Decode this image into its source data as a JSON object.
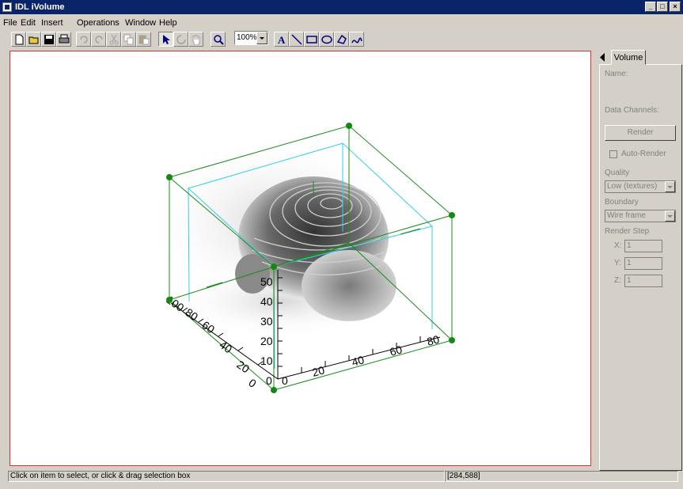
{
  "window": {
    "title": "IDL iVolume",
    "minimize": "_",
    "maximize": "□",
    "close": "×"
  },
  "menu": [
    "File",
    "Edit",
    "Insert",
    "Operations",
    "Window",
    "Help"
  ],
  "toolbar": {
    "zoom_value": "100%",
    "text_tool_label": "A",
    "icons": [
      "new-file-icon",
      "open-folder-icon",
      "save-icon",
      "print-icon",
      "undo-icon",
      "redo-icon",
      "cut-icon",
      "copy-icon",
      "paste-icon",
      "select-arrow-icon",
      "rotate-icon",
      "pan-hand-icon",
      "zoom-icon",
      "text-icon",
      "line-icon",
      "rectangle-icon",
      "ellipse-icon",
      "polygon-icon",
      "freehand-icon"
    ]
  },
  "canvas": {
    "axis_y_ticks": [
      "0",
      "10",
      "20",
      "30",
      "40",
      "50"
    ],
    "axis_x_ticks": [
      "0",
      "20",
      "40",
      "60",
      "80"
    ],
    "axis_z_ticks": [
      "0",
      "20",
      "40",
      "60",
      "80",
      "100"
    ],
    "colors": {
      "bbox": "#1a8a1a",
      "inner_box": "#30d0e0",
      "handle": "#128a12",
      "border": "#e03030"
    }
  },
  "panel": {
    "tab": "Volume",
    "name_label": "Name:",
    "data_channels_label": "Data Channels:",
    "render_button": "Render",
    "auto_render_label": "Auto-Render",
    "quality_label": "Quality",
    "quality_value": "Low (textures)",
    "boundary_label": "Boundary",
    "boundary_value": "Wire frame",
    "render_step_label": "Render Step",
    "step_x_label": "X:",
    "step_x_value": "1",
    "step_y_label": "Y:",
    "step_y_value": "1",
    "step_z_label": "Z:",
    "step_z_value": "1"
  },
  "status": {
    "message": "Click on item to select, or click & drag selection box",
    "coords": "[284,588]"
  }
}
